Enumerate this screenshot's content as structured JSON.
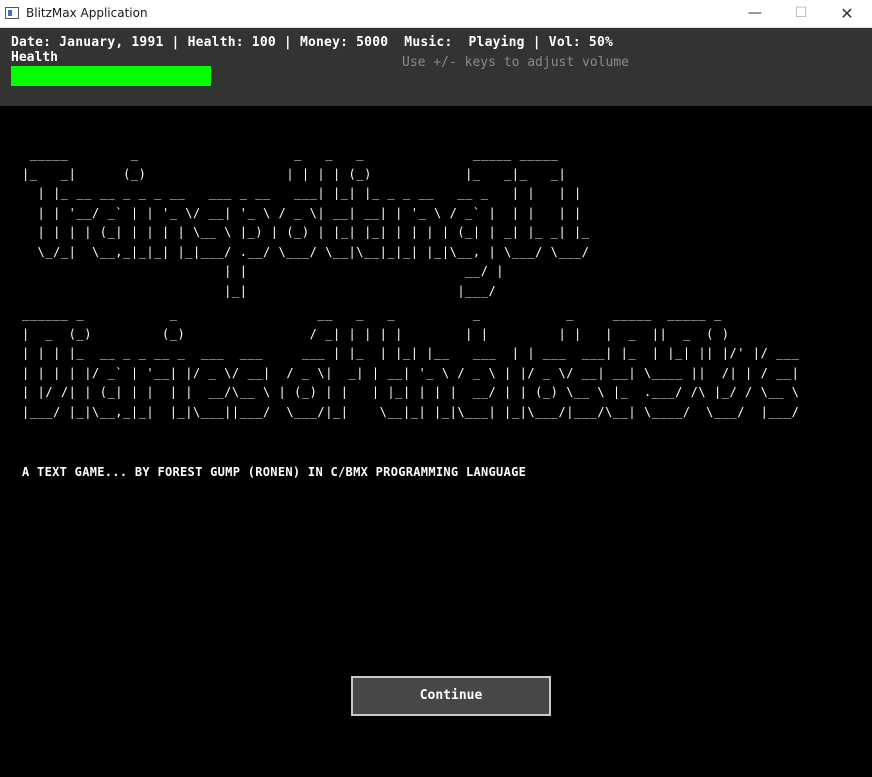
{
  "window": {
    "title": "BlitzMax Application",
    "minimize_glyph": "—",
    "maximize_glyph": "☐",
    "close_glyph": "✕"
  },
  "status": {
    "line": "Date: January, 1991 | Health: 100 | Money: 5000  Music:  Playing | Vol: 50%",
    "health_label": "Health",
    "health_fraction": 1.0,
    "health_color": "#00ff00",
    "volume_hint": "Use +/- keys to adjust volume"
  },
  "ascii_title": " _____        _                    _   _   _              _____ _____\n|_   _|      (_)                  | | | | (_)            |_   _|_   _|\n  | |_ __ __ _ _ _ __   ___ _ __   ___| |_| |_ _ _ __   __ _   | |   | |\n  | | '__/ _` | | '_ \\/ __| '_ \\ / _ \\| __| __| | '_ \\ / _` |  | |   | |\n  | | | | (_| | | | | \\__ \\ |_) | (_) | |_| |_| | | | | (_| | _| |_ _| |_\n  \\_/_|  \\__,_|_|_| |_|___/ .__/ \\___/ \\__|\\__|_|_| |_|\\__, | \\___/ \\___/\n                          | |                            __/ |\n                          |_|                           |___/",
  "ascii_subtitle": "______ _           _                  __   _   _          _           _     _____  _____ _\n|  _  (_)         (_)                / _| | | | |        | |         | |   |  _  ||  _  ( )\n| | | |_  __ _ _ __ _  ___  ___     ___ | |_  | |_| |__   ___  | | ___  ___| |_  | |_| || |/' |/ ___\n| | | | |/ _` | '__| |/ _ \\/ __|  / _ \\|  _| | __| '_ \\ / _ \\ | |/ _ \\/ __| __| \\____ ||  /| | / __|\n| |/ /| | (_| | |  | |  __/\\__ \\ | (_) | |   | |_| | | |  __/ | | (_) \\__ \\ |_  .___/ /\\ |_/ / \\__ \\\n|___/ |_|\\__,_|_|  |_|\\___||___/  \\___/|_|    \\__|_| |_|\\___| |_|\\___/|___/\\__| \\____/  \\___/  |___/",
  "byline": "A TEXT GAME... BY FOREST GUMP (RONEN) IN C/BMX PROGRAMMING LANGUAGE",
  "continue_label": "Continue"
}
